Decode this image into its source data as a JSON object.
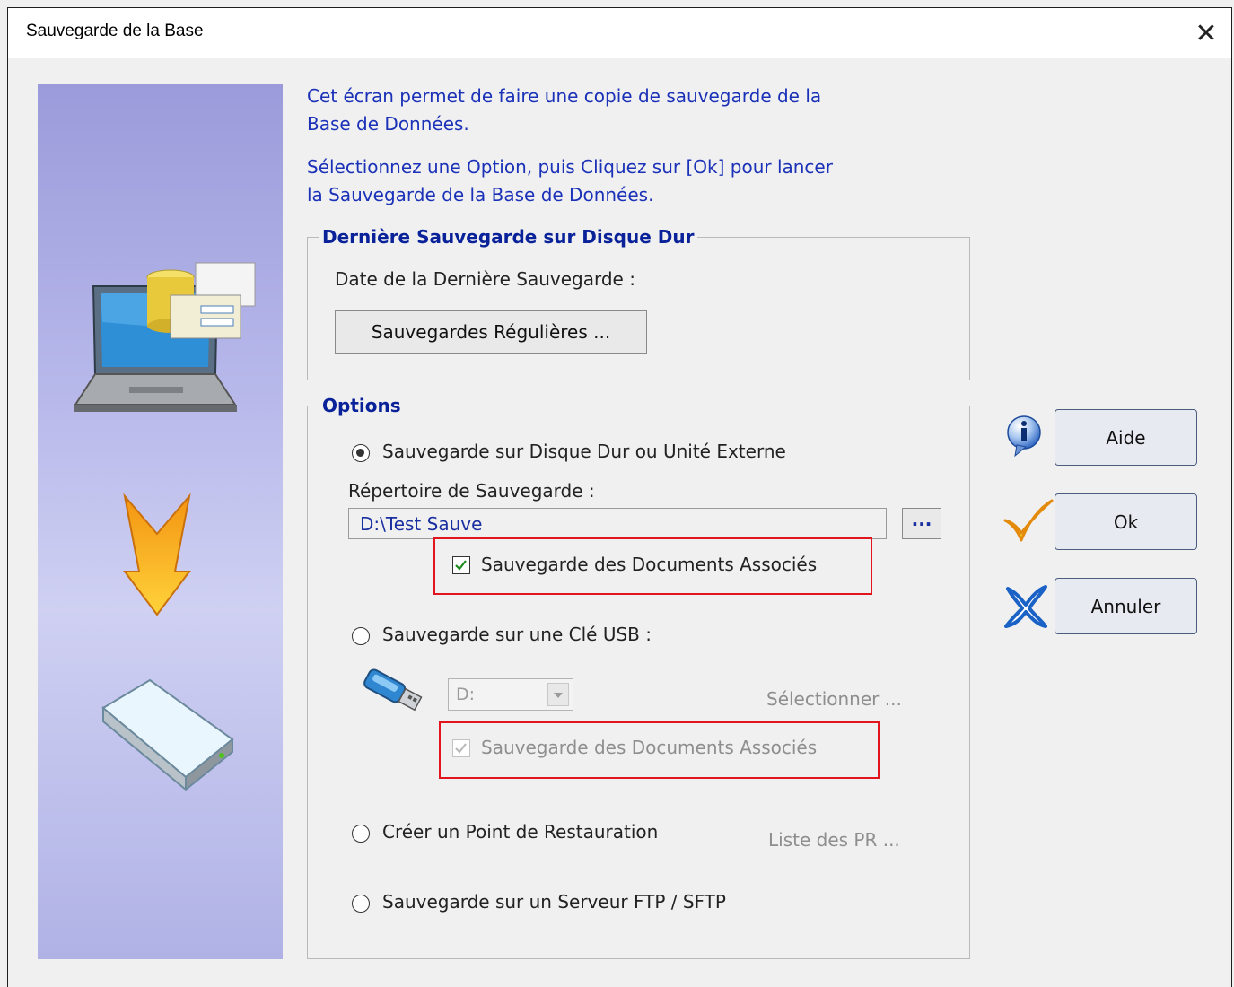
{
  "window": {
    "title": "Sauvegarde de la Base",
    "close_glyph": "✕"
  },
  "intro": {
    "line1": "Cet écran permet de faire une copie de sauvegarde de la",
    "line2": "Base de Données.",
    "line3": "Sélectionnez une Option, puis Cliquez sur [Ok] pour lancer",
    "line4": "la Sauvegarde de la Base de Données."
  },
  "last_backup": {
    "legend": "Dernière Sauvegarde sur Disque Dur",
    "date_label": "Date de la Dernière Sauvegarde :",
    "regular_button": "Sauvegardes Régulières ..."
  },
  "options": {
    "legend": "Options",
    "disk": {
      "label": "Sauvegarde sur Disque Dur ou Unité Externe",
      "selected": true,
      "dir_label": "Répertoire de Sauvegarde :",
      "dir_value": "D:\\Test Sauve",
      "browse_button": "...",
      "docs_label": "Sauvegarde des Documents Associés",
      "docs_checked": true
    },
    "usb": {
      "label": "Sauvegarde sur une Clé USB :",
      "selected": false,
      "drive_value": "D:",
      "select_link": "Sélectionner ...",
      "docs_label": "Sauvegarde des Documents Associés",
      "docs_checked": true,
      "disabled": true
    },
    "restore_point": {
      "label": "Créer un Point de Restauration",
      "selected": false,
      "list_link": "Liste des PR ..."
    },
    "ftp": {
      "label": "Sauvegarde sur un Serveur FTP / SFTP",
      "selected": false
    }
  },
  "buttons": {
    "help": "Aide",
    "ok": "Ok",
    "cancel": "Annuler"
  },
  "icons": {
    "laptop": "laptop-database-icon",
    "arrow": "down-arrow-icon",
    "disk": "external-disk-icon",
    "usb": "usb-key-icon",
    "info": "info-icon",
    "check": "checkmark-icon",
    "cross": "cross-icon"
  },
  "colors": {
    "accent_text": "#1a31b8",
    "legend_text": "#0a2299",
    "highlight_box": "#e2141e",
    "side_panel": "#a9aae3"
  }
}
